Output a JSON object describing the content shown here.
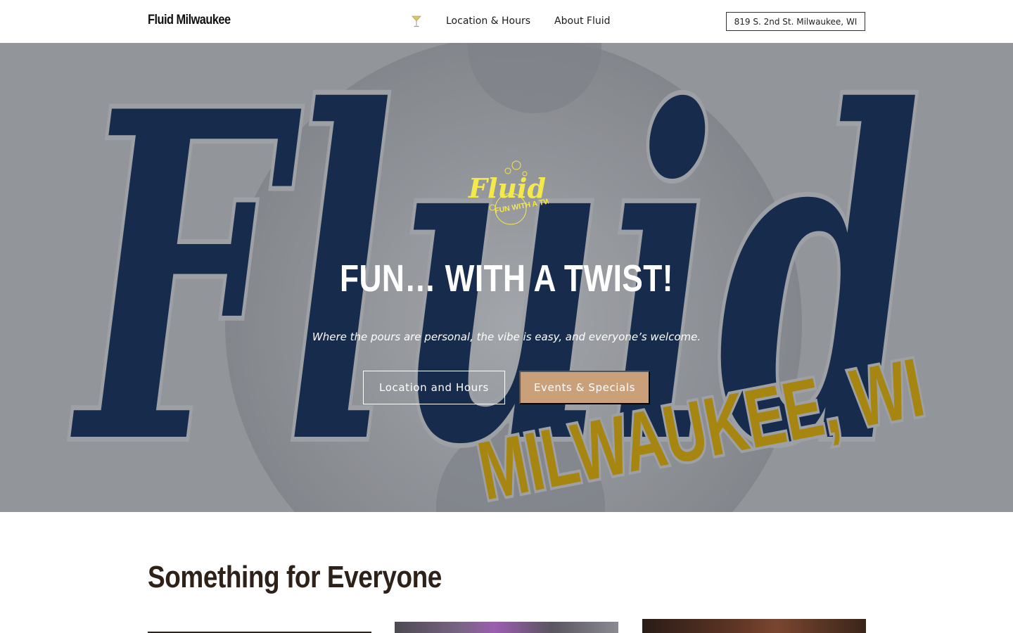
{
  "header": {
    "brand": "Fluid Milwaukee",
    "nav": {
      "icon": "cocktail-glass-icon",
      "items": [
        "Location & Hours",
        "About Fluid"
      ]
    },
    "address_button": "819 S. 2nd St. Milwaukee, WI"
  },
  "hero": {
    "background_text": "Fluid",
    "background_subtext": "MILWAUKEE, WI",
    "logo": {
      "word": "Fluid",
      "tagline": "FUN WITH A TWIST"
    },
    "title": "FUN… WITH A TWIST!",
    "subtitle": "Where the pours are personal, the vibe is easy, and everyone’s welcome.",
    "buttons": {
      "primary": "Location and Hours",
      "secondary": "Events & Specials"
    }
  },
  "section": {
    "title": "Something for Everyone",
    "card_count": 3
  },
  "colors": {
    "navy": "#0d2246",
    "gold": "#a98405",
    "accent_button": "#caa07a",
    "hero_overlay": "#8f9296",
    "logo_yellow": "#f5e84a",
    "heading": "#2d2119"
  }
}
